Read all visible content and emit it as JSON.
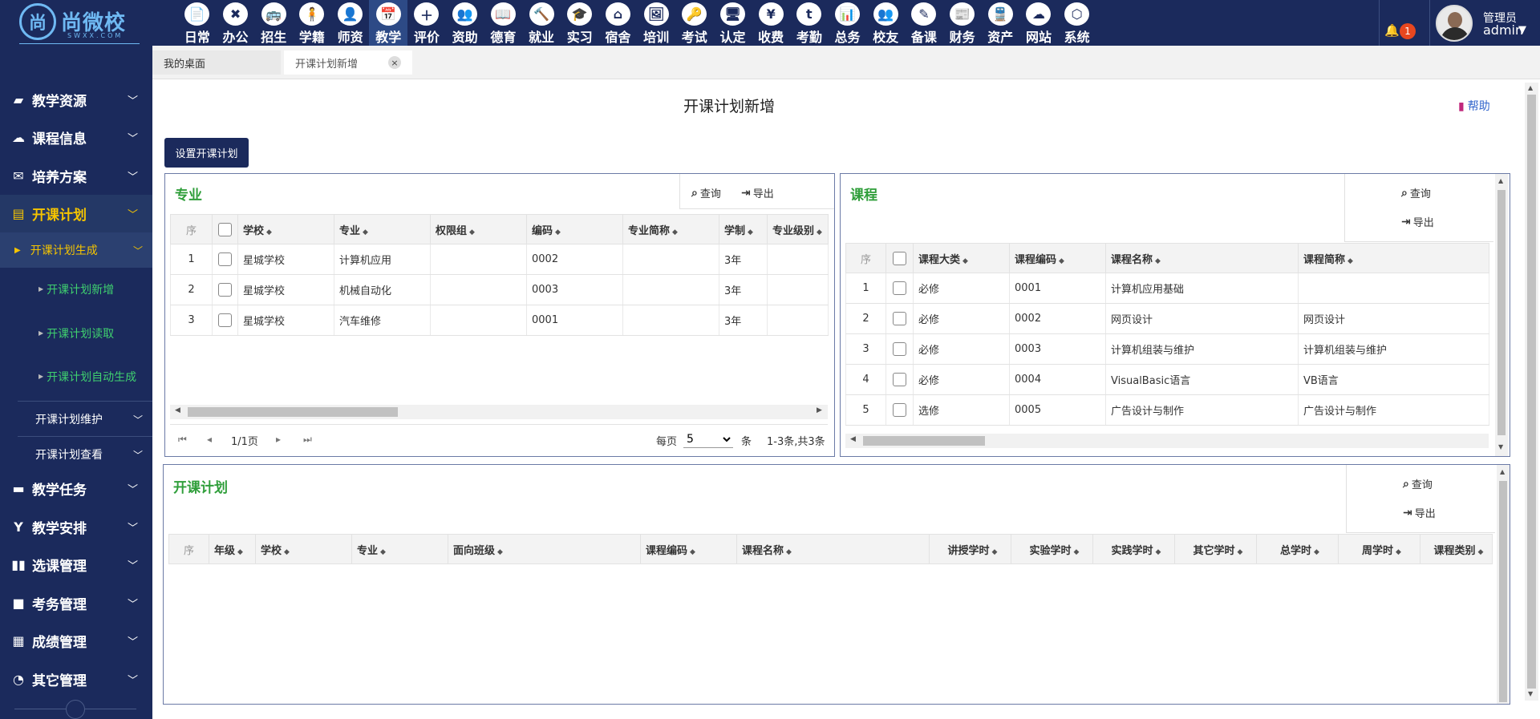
{
  "brand": {
    "logo_mark": "尚",
    "name": "尚微校",
    "sub": "SWXX.COM"
  },
  "modules": [
    {
      "icon": "📄",
      "icon_name": "document-icon",
      "label": "日常"
    },
    {
      "icon": "✖",
      "icon_name": "office-icon",
      "label": "办公"
    },
    {
      "icon": "🚌",
      "icon_name": "bus-icon",
      "label": "招生"
    },
    {
      "icon": "🧍",
      "icon_name": "student-icon",
      "label": "学籍"
    },
    {
      "icon": "👤",
      "icon_name": "teacher-icon",
      "label": "师资"
    },
    {
      "icon": "📅",
      "icon_name": "calendar-icon",
      "label": "教学",
      "active": true
    },
    {
      "icon": "＋",
      "icon_name": "evaluate-icon",
      "label": "评价"
    },
    {
      "icon": "👥",
      "icon_name": "aid-icon",
      "label": "资助"
    },
    {
      "icon": "📖",
      "icon_name": "book-icon",
      "label": "德育"
    },
    {
      "icon": "🔨",
      "icon_name": "hammer-icon",
      "label": "就业"
    },
    {
      "icon": "🎓",
      "icon_name": "internship-icon",
      "label": "实习"
    },
    {
      "icon": "⌂",
      "icon_name": "home-icon",
      "label": "宿舍"
    },
    {
      "icon": "🖼",
      "icon_name": "image-icon",
      "label": "培训"
    },
    {
      "icon": "🔑",
      "icon_name": "key-icon",
      "label": "考试"
    },
    {
      "icon": "🖥",
      "icon_name": "monitor-icon",
      "label": "认定"
    },
    {
      "icon": "¥",
      "icon_name": "yen-icon",
      "label": "收费"
    },
    {
      "icon": "t",
      "icon_name": "attendance-icon",
      "label": "考勤"
    },
    {
      "icon": "📊",
      "icon_name": "chart-icon",
      "label": "总务"
    },
    {
      "icon": "👥",
      "icon_name": "alumni-icon",
      "label": "校友"
    },
    {
      "icon": "✎",
      "icon_name": "edit-icon",
      "label": "备课"
    },
    {
      "icon": "📰",
      "icon_name": "newspaper-icon",
      "label": "财务"
    },
    {
      "icon": "🚆",
      "icon_name": "train-icon",
      "label": "资产"
    },
    {
      "icon": "☁",
      "icon_name": "cloud-icon",
      "label": "网站"
    },
    {
      "icon": "⬡",
      "icon_name": "cube-icon",
      "label": "系统"
    }
  ],
  "header": {
    "notifications": "1",
    "role": "管理员",
    "username": "admin"
  },
  "sidebar": {
    "items": [
      {
        "icon": "▰",
        "icon_name": "book-icon",
        "label": "教学资源"
      },
      {
        "icon": "☁",
        "icon_name": "cloud-icon",
        "label": "课程信息"
      },
      {
        "icon": "✉",
        "icon_name": "envelope-icon",
        "label": "培养方案"
      },
      {
        "icon": "▤",
        "icon_name": "file-icon",
        "label": "开课计划"
      }
    ],
    "sub_generate": "开课计划生成",
    "leaves": [
      "开课计划新增",
      "开课计划读取",
      "开课计划自动生成"
    ],
    "subs": [
      "开课计划维护",
      "开课计划查看"
    ],
    "items2": [
      {
        "icon": "▬",
        "icon_name": "folder-icon",
        "label": "教学任务"
      },
      {
        "icon": "Y",
        "icon_name": "schedule-icon",
        "label": "教学安排"
      },
      {
        "icon": "▮▮",
        "icon_name": "columns-icon",
        "label": "选课管理"
      },
      {
        "icon": "■",
        "icon_name": "exam-icon",
        "label": "考务管理"
      },
      {
        "icon": "▦",
        "icon_name": "grid-icon",
        "label": "成绩管理"
      },
      {
        "icon": "◔",
        "icon_name": "pie-icon",
        "label": "其它管理"
      }
    ]
  },
  "tabs": [
    {
      "label": "我的桌面"
    },
    {
      "label": "开课计划新增",
      "close": "×"
    }
  ],
  "page": {
    "title": "开课计划新增",
    "help": "帮助",
    "setup_button": "设置开课计划"
  },
  "toolbar": {
    "query": "查询",
    "export": "导出"
  },
  "major_panel": {
    "title": "专业",
    "columns": [
      "序",
      "",
      "学校",
      "专业",
      "权限组",
      "编码",
      "专业简称",
      "学制",
      "专业级别"
    ],
    "rows": [
      {
        "no": "1",
        "school": "星城学校",
        "major": "计算机应用",
        "group": "",
        "code": "0002",
        "short": "",
        "years": "3年",
        "level": ""
      },
      {
        "no": "2",
        "school": "星城学校",
        "major": "机械自动化",
        "group": "",
        "code": "0003",
        "short": "",
        "years": "3年",
        "level": ""
      },
      {
        "no": "3",
        "school": "星城学校",
        "major": "汽车维修",
        "group": "",
        "code": "0001",
        "short": "",
        "years": "3年",
        "level": ""
      }
    ],
    "pager": {
      "page": "1/1页",
      "per_page_label": "每页",
      "per_page": "5",
      "unit": "条",
      "summary": "1-3条,共3条"
    }
  },
  "course_panel": {
    "title": "课程",
    "columns": [
      "序",
      "",
      "课程大类",
      "课程编码",
      "课程名称",
      "课程简称"
    ],
    "rows": [
      {
        "no": "1",
        "category": "必修",
        "code": "0001",
        "name": "计算机应用基础",
        "short": ""
      },
      {
        "no": "2",
        "category": "必修",
        "code": "0002",
        "name": "网页设计",
        "short": "网页设计"
      },
      {
        "no": "3",
        "category": "必修",
        "code": "0003",
        "name": "计算机组装与维护",
        "short": "计算机组装与维护"
      },
      {
        "no": "4",
        "category": "必修",
        "code": "0004",
        "name": "VisualBasic语言",
        "short": "VB语言"
      },
      {
        "no": "5",
        "category": "选修",
        "code": "0005",
        "name": "广告设计与制作",
        "short": "广告设计与制作"
      }
    ]
  },
  "plan_panel": {
    "title": "开课计划",
    "columns": [
      "序",
      "年级",
      "学校",
      "专业",
      "面向班级",
      "课程编码",
      "课程名称",
      "讲授学时",
      "实验学时",
      "实践学时",
      "其它学时",
      "总学时",
      "周学时",
      "课程类别"
    ]
  }
}
